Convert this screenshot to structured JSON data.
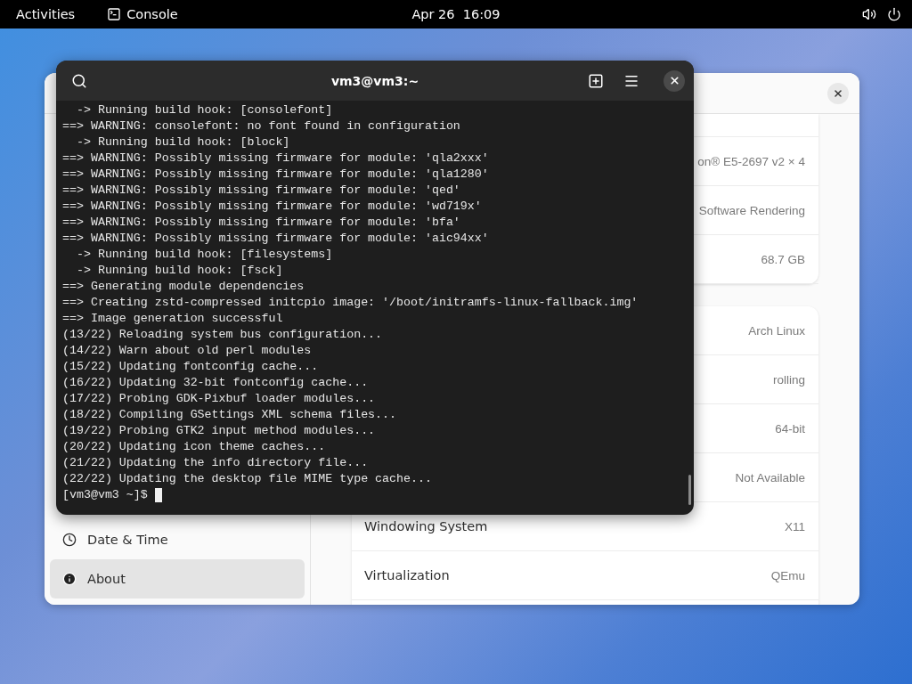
{
  "top_bar": {
    "activities": "Activities",
    "app_name": "Console",
    "clock": "Apr 26  16:09"
  },
  "settings": {
    "sidebar": [
      {
        "kind": "clock",
        "label": "Date & Time",
        "selected": false
      },
      {
        "kind": "info",
        "label": "About",
        "selected": true
      }
    ],
    "hardware_rows": [
      {
        "value": "on® E5-2697 v2 × 4"
      },
      {
        "value": "Software Rendering"
      },
      {
        "value": "68.7 GB"
      }
    ],
    "system_rows": [
      {
        "value": "Arch Linux"
      },
      {
        "value": "rolling"
      },
      {
        "value": "64-bit"
      },
      {
        "value": "Not Available"
      },
      {
        "label": "Windowing System",
        "value": "X11"
      },
      {
        "label": "Virtualization",
        "value": "QEmu"
      }
    ]
  },
  "terminal": {
    "title": "vm3@vm3:~",
    "lines": [
      "  -> Running build hook: [consolefont]",
      "==> WARNING: consolefont: no font found in configuration",
      "  -> Running build hook: [block]",
      "==> WARNING: Possibly missing firmware for module: 'qla2xxx'",
      "==> WARNING: Possibly missing firmware for module: 'qla1280'",
      "==> WARNING: Possibly missing firmware for module: 'qed'",
      "==> WARNING: Possibly missing firmware for module: 'wd719x'",
      "==> WARNING: Possibly missing firmware for module: 'bfa'",
      "==> WARNING: Possibly missing firmware for module: 'aic94xx'",
      "  -> Running build hook: [filesystems]",
      "  -> Running build hook: [fsck]",
      "==> Generating module dependencies",
      "==> Creating zstd-compressed initcpio image: '/boot/initramfs-linux-fallback.img'",
      "==> Image generation successful",
      "(13/22) Reloading system bus configuration...",
      "(14/22) Warn about old perl modules",
      "(15/22) Updating fontconfig cache...",
      "(16/22) Updating 32-bit fontconfig cache...",
      "(17/22) Probing GDK-Pixbuf loader modules...",
      "(18/22) Compiling GSettings XML schema files...",
      "(19/22) Probing GTK2 input method modules...",
      "(20/22) Updating icon theme caches...",
      "(21/22) Updating the info directory file...",
      "(22/22) Updating the desktop file MIME type cache..."
    ],
    "prompt": "[vm3@vm3 ~]$"
  }
}
